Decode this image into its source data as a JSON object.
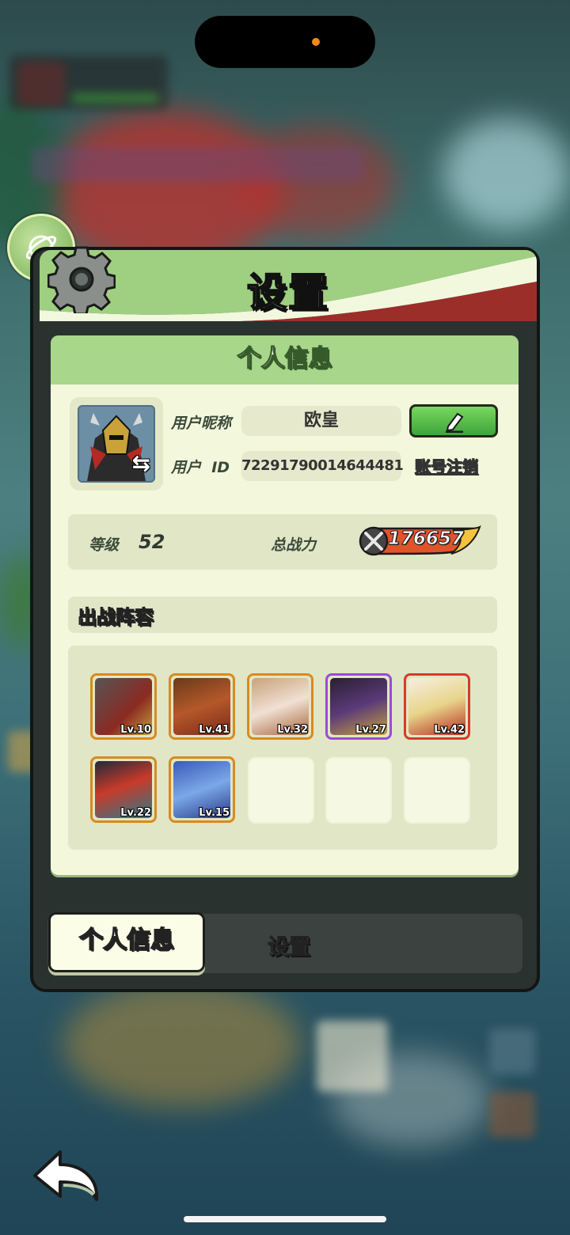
{
  "header": {
    "title": "设置"
  },
  "card": {
    "title": "个人信息"
  },
  "profile": {
    "nickname_label": "用户昵称",
    "nickname": "欧皇",
    "id_label": "用户  ID",
    "user_id": "72291790014644481",
    "deregister_label": "账号注销"
  },
  "stats": {
    "level_label": "等级",
    "level": "52",
    "power_label": "总战力",
    "power": "176657"
  },
  "lineup": {
    "title": "出战阵容",
    "heroes": [
      {
        "level": "Lv.10",
        "rarity_color": "#d98a1e"
      },
      {
        "level": "Lv.41",
        "rarity_color": "#d98a1e"
      },
      {
        "level": "Lv.32",
        "rarity_color": "#d98a1e"
      },
      {
        "level": "Lv.27",
        "rarity_color": "#9b4bd6"
      },
      {
        "level": "Lv.42",
        "rarity_color": "#d63a2a"
      },
      {
        "level": "Lv.22",
        "rarity_color": "#d98a1e"
      },
      {
        "level": "Lv.15",
        "rarity_color": "#d98a1e"
      }
    ]
  },
  "tabs": {
    "active": "个人信息",
    "inactive": "设置"
  },
  "colors": {
    "header_green": "#a8d68a",
    "card_bg": "#f3f8dc",
    "edit_green": "#4fb845"
  }
}
